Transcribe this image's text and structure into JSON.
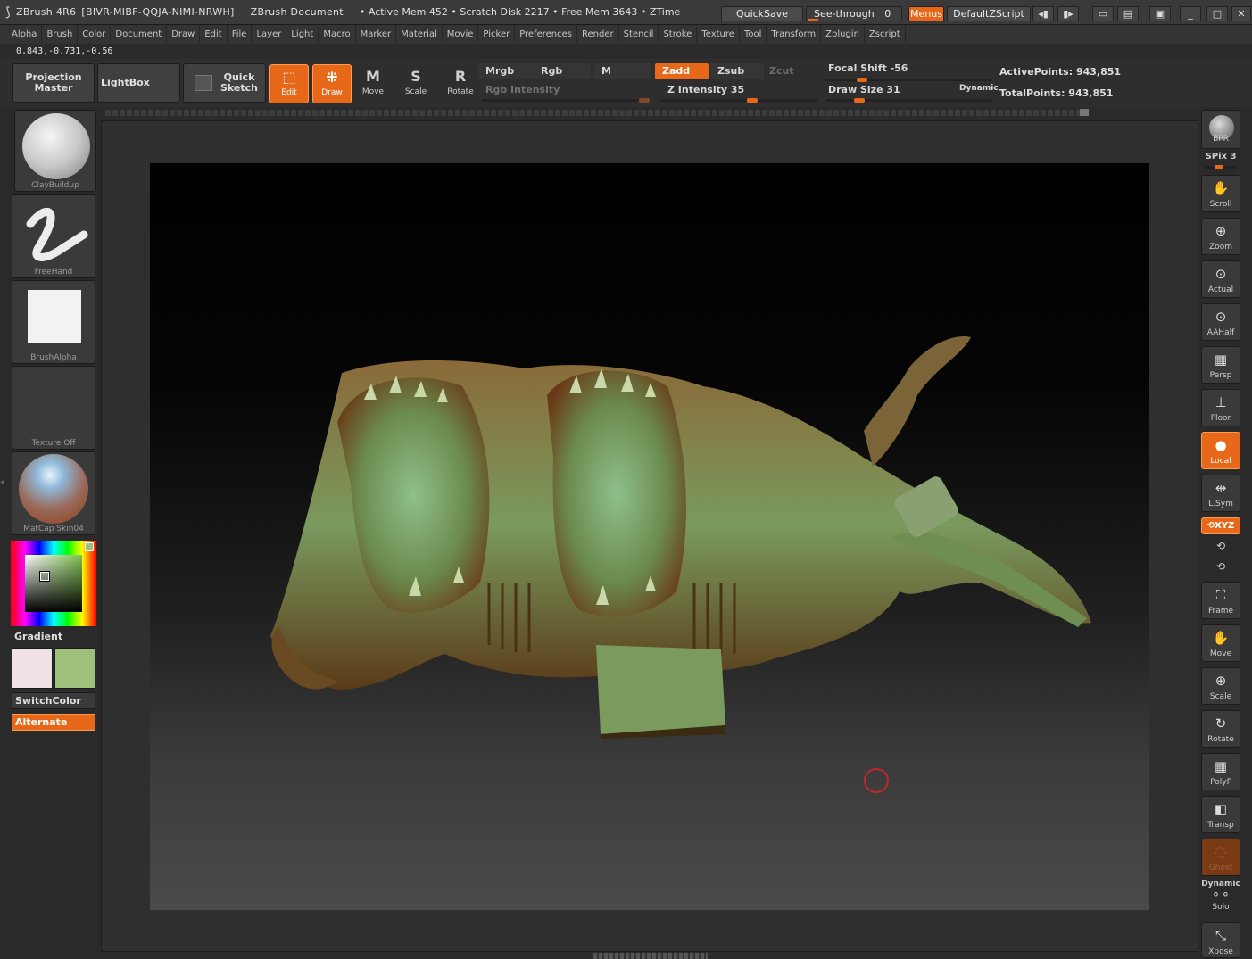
{
  "titlebar": {
    "app": "ZBrush 4R6",
    "serial": "[BIVR-MIBF-QQJA-NIMI-NRWH]",
    "document": "ZBrush Document",
    "stats": "• Active Mem 452 • Scratch Disk 2217 • Free Mem 3643 • ZTime",
    "quicksave": "QuickSave",
    "seethrough_label": "See-through",
    "seethrough_value": "0",
    "menus": "Menus",
    "script": "DefaultZScript"
  },
  "menubar": [
    "Alpha",
    "Brush",
    "Color",
    "Document",
    "Draw",
    "Edit",
    "File",
    "Layer",
    "Light",
    "Macro",
    "Marker",
    "Material",
    "Movie",
    "Picker",
    "Preferences",
    "Render",
    "Stencil",
    "Stroke",
    "Texture",
    "Tool",
    "Transform",
    "Zplugin",
    "Zscript"
  ],
  "coords": "0.843,-0.731,-0.56",
  "toolbar": {
    "projection_master": "Projection\nMaster",
    "lightbox": "LightBox",
    "quick_sketch": "Quick\nSketch",
    "edit": "Edit",
    "draw": "Draw",
    "move": "Move",
    "scale": "Scale",
    "rotate": "Rotate",
    "mrgb": "Mrgb",
    "rgb": "Rgb",
    "m": "M",
    "zadd": "Zadd",
    "zsub": "Zsub",
    "zcut": "Zcut",
    "rgb_intensity": "Rgb Intensity",
    "z_intensity": "Z Intensity 35",
    "focal_shift": "Focal Shift -56",
    "draw_size": "Draw Size 31",
    "dynamic": "Dynamic",
    "active_points": "ActivePoints: 943,851",
    "total_points": "TotalPoints: 943,851"
  },
  "left": {
    "brush": "ClayBuildup",
    "stroke": "FreeHand",
    "alpha": "BrushAlpha",
    "texture": "Texture Off",
    "material": "MatCap Skin04",
    "gradient": "Gradient",
    "switchcolor": "SwitchColor",
    "alternate": "Alternate"
  },
  "right": {
    "bpr": "BPR",
    "spix": "SPix 3",
    "scroll": "Scroll",
    "zoom": "Zoom",
    "actual": "Actual",
    "aahalf": "AAHalf",
    "persp": "Persp",
    "floor": "Floor",
    "local": "Local",
    "lsym": "L.Sym",
    "xyz": "XYZ",
    "frame": "Frame",
    "move": "Move",
    "scale": "Scale",
    "rotate": "Rotate",
    "polyf": "PolyF",
    "transp": "Transp",
    "ghost": "Ghost",
    "dynamic": "Dynamic",
    "solo": "Solo",
    "xpose": "Xpose"
  },
  "colors": {
    "accent": "#e8681a",
    "secondary_color": "#f0e2e4",
    "main_color": "#9dc07a",
    "model": "#6f8f52"
  }
}
